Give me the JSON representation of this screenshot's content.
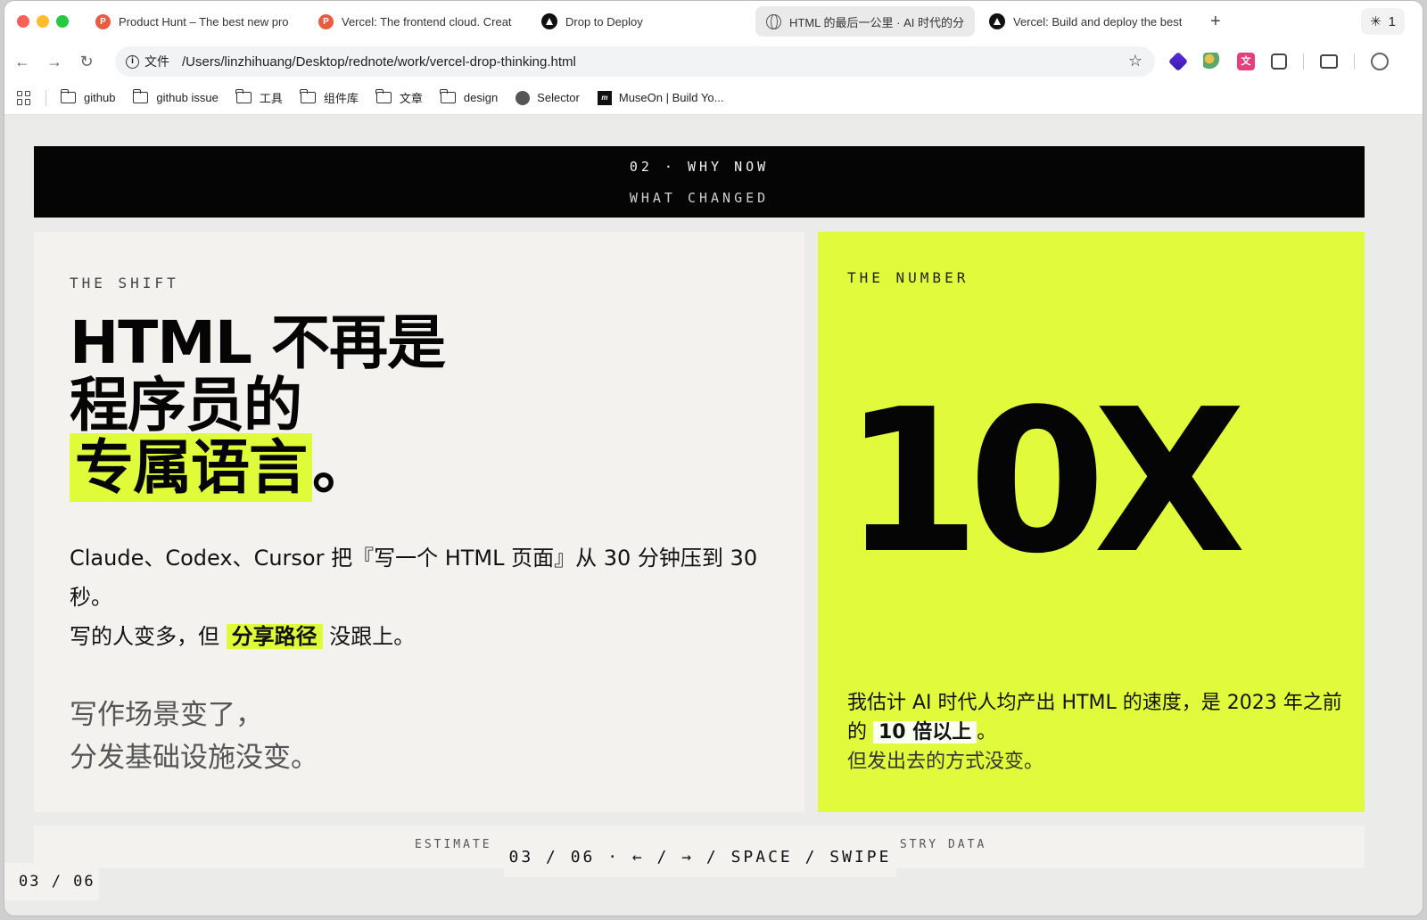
{
  "tabs": [
    {
      "title": "Product Hunt – The best new pro",
      "favicon": "product-hunt-icon",
      "active": false
    },
    {
      "title": "Vercel: The frontend cloud. Creat",
      "favicon": "product-hunt-icon",
      "active": false
    },
    {
      "title": "Drop to Deploy",
      "favicon": "vercel-icon",
      "active": false
    },
    {
      "title": "HTML 的最后一公里 · AI 时代的分享",
      "favicon": "globe-icon",
      "active": true
    },
    {
      "title": "Vercel: Build and deploy the best",
      "favicon": "vercel-icon",
      "active": false
    }
  ],
  "tab_right": {
    "count": "1"
  },
  "address": {
    "file_label": "文件",
    "url": "/Users/linzhihuang/Desktop/rednote/work/vercel-drop-thinking.html"
  },
  "bookmarks": [
    {
      "label": "github",
      "icon": "folder-icon"
    },
    {
      "label": "github issue",
      "icon": "folder-icon"
    },
    {
      "label": "工具",
      "icon": "folder-icon"
    },
    {
      "label": "组件库",
      "icon": "folder-icon"
    },
    {
      "label": "文章",
      "icon": "folder-icon"
    },
    {
      "label": "design",
      "icon": "folder-icon"
    },
    {
      "label": "Selector",
      "icon": "selector-icon"
    },
    {
      "label": "MuseOn | Build Yo...",
      "icon": "museon-icon"
    }
  ],
  "slide": {
    "banner_line1": "02 · WHY NOW",
    "banner_line2": "WHAT CHANGED",
    "shift": {
      "label": "THE SHIFT",
      "headline_line1": "HTML 不再是",
      "headline_line2": "程序员的",
      "headline_mark": "专属语言",
      "headline_end": "。",
      "body_line1": "Claude、Codex、Cursor 把『写一个 HTML 页面』从 30 分钟压到 30 秒。",
      "body_line2_pre": "写的人变多，但 ",
      "body_line2_mark": "分享路径",
      "body_line2_post": " 没跟上。",
      "serif_line1": "写作场景变了，",
      "serif_line2": "分发基础设施没变。"
    },
    "number": {
      "label": "THE NUMBER",
      "value": "10X",
      "copy_pre": "我估计 AI 时代人均产出 HTML 的速度，是 2023 年之前的 ",
      "copy_emph": "10 倍以上",
      "copy_post": "。",
      "copy_sub": "但发出去的方式没变。"
    },
    "strip_left": "ESTIMATE ·",
    "strip_right": "USTRY DATA",
    "nav_hint": "03 / 06 · ← / → / SPACE / SWIPE",
    "page_counter": "03 / 06"
  },
  "colors": {
    "accent": "#e1fb3c",
    "banner": "#050505",
    "card": "#f3f2ef"
  }
}
